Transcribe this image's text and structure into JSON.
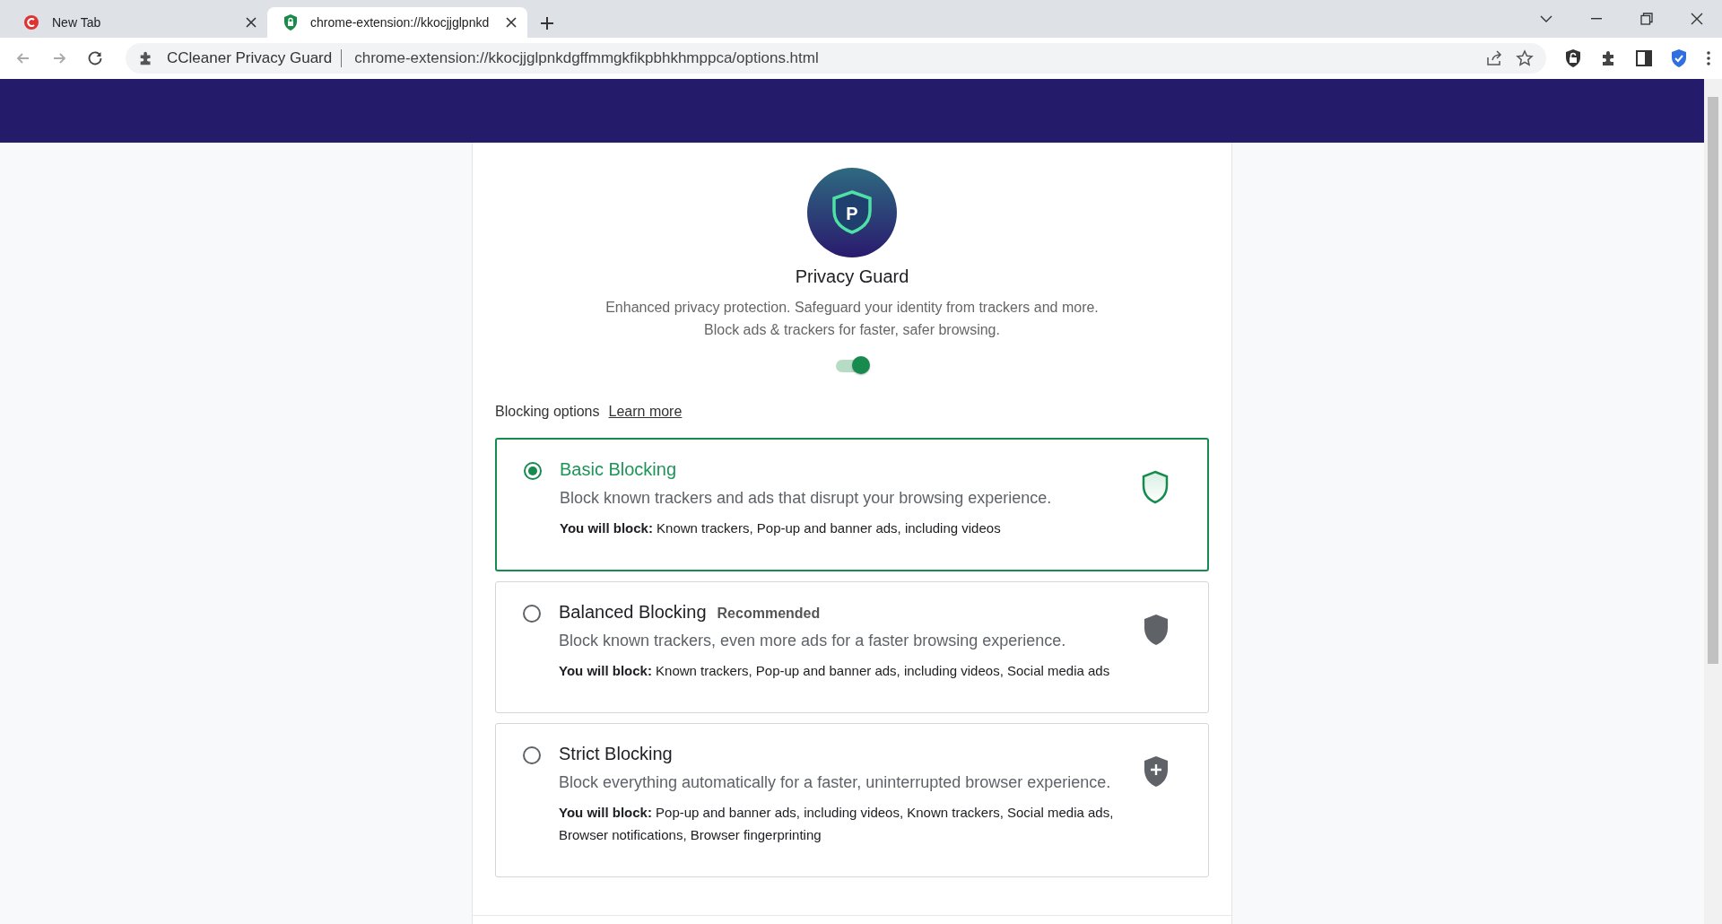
{
  "browser": {
    "tabs": [
      {
        "title": "New Tab",
        "selected": false,
        "kind": "ccleaner"
      },
      {
        "title": "chrome-extension://kkocjjglpnkd",
        "selected": true,
        "kind": "shield"
      }
    ],
    "omnibox": {
      "site": "CCleaner Privacy Guard",
      "url": "chrome-extension://kkocjjglpnkdgffmmgkfikpbhkhmppca/options.html"
    }
  },
  "app": {
    "logo_letter": "P",
    "title": "Privacy Guard",
    "description": [
      "Enhanced privacy protection. Safeguard your identity from trackers and more.",
      "Block ads & trackers for faster, safer browsing."
    ],
    "enabled": true,
    "section_label": "Blocking options",
    "learn_more": "Learn more",
    "options": [
      {
        "kind": "basic",
        "title": "Basic Blocking",
        "selected": true,
        "description": "Block known trackers and ads that disrupt your browsing experience.",
        "blocks": "**You will block:** Known trackers, Pop-up and banner ads, including videos"
      },
      {
        "kind": "balanced",
        "title": "Balanced Blocking",
        "badge": "Recommended",
        "selected": false,
        "description": "Block known trackers, even more ads for a faster browsing experience.",
        "blocks": "**You will block:** Known trackers, Pop-up and banner ads, including videos, Social media ads"
      },
      {
        "kind": "strict",
        "title": "Strict Blocking",
        "selected": false,
        "description": "Block everything automatically for a faster, uninterrupted browser experience.",
        "blocks": "**You will block:** Pop-up and banner ads, including videos, Known trackers, Social media ads, Browser notifications, Browser fingerprinting"
      }
    ]
  }
}
